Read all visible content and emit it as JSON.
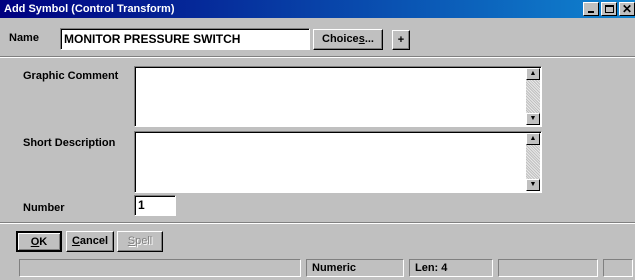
{
  "window": {
    "title": "Add  Symbol (Control Transform)",
    "minimize_icon": "minimize-icon",
    "maximize_icon": "maximize-icon",
    "close_icon": "close-icon",
    "close_glyph": "✕"
  },
  "form": {
    "name_label": "Name",
    "name_value": "MONITOR PRESSURE SWITCH",
    "choices_label_prefix": "Choice",
    "choices_label_underline": "s",
    "choices_label_suffix": "...",
    "plus_label": "+",
    "graphic_comment_label": "Graphic Comment",
    "graphic_comment_value": "",
    "short_description_label": "Short Description",
    "short_description_value": "",
    "number_label": "Number",
    "number_value": "1",
    "scroll_up_glyph": "▲",
    "scroll_down_glyph": "▼"
  },
  "buttons": {
    "ok_underline": "O",
    "ok_rest": "K",
    "cancel_underline": "C",
    "cancel_rest": "ancel",
    "spell_underline": "S",
    "spell_rest": "pell"
  },
  "statusbar": {
    "panel_1": "",
    "mode": "Numeric",
    "length": "Len: 4",
    "panel_4": "",
    "panel_5": ""
  }
}
